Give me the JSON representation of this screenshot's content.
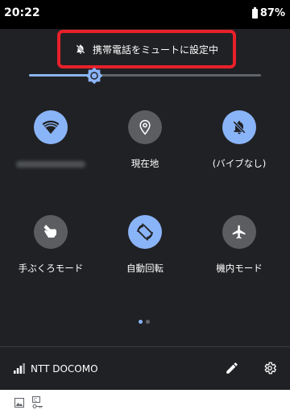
{
  "status_bar": {
    "time": "20:22",
    "battery": "87%"
  },
  "toast": {
    "text": "携帯電話をミュートに設定中"
  },
  "brightness": {
    "level_percent": 28
  },
  "tiles": [
    {
      "label": "",
      "state": "on",
      "icon": "wifi-icon"
    },
    {
      "label": "現在地",
      "state": "off",
      "icon": "location-icon"
    },
    {
      "label": "(バイブなし)",
      "state": "on",
      "icon": "bell-off-icon"
    },
    {
      "label": "手ぶくろモード",
      "state": "off",
      "icon": "glove-hand-icon"
    },
    {
      "label": "自動回転",
      "state": "on",
      "icon": "auto-rotate-icon"
    },
    {
      "label": "機内モード",
      "state": "off",
      "icon": "airplane-icon"
    }
  ],
  "footer": {
    "carrier": "NTT DOCOMO"
  },
  "colors": {
    "accent": "#8ab4f8",
    "shade": "#202124",
    "toast_border": "#e8202a"
  }
}
